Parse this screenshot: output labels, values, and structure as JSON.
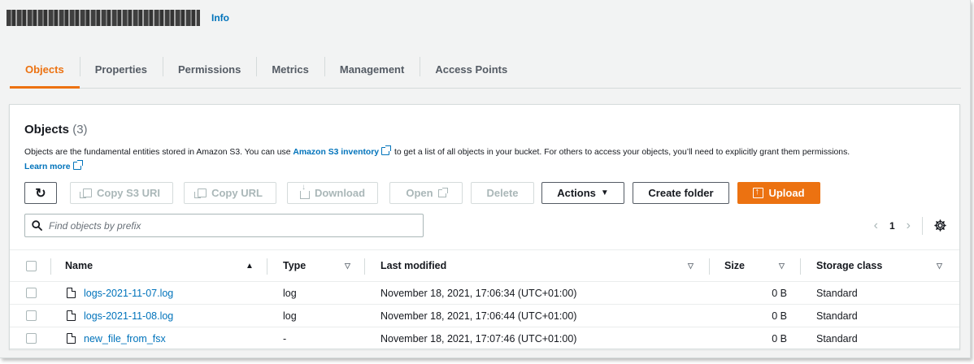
{
  "header": {
    "info_label": "Info"
  },
  "tabs": [
    {
      "label": "Objects",
      "active": true
    },
    {
      "label": "Properties"
    },
    {
      "label": "Permissions"
    },
    {
      "label": "Metrics"
    },
    {
      "label": "Management"
    },
    {
      "label": "Access Points"
    }
  ],
  "objects": {
    "title": "Objects",
    "count": "(3)",
    "description_part1": "Objects are the fundamental entities stored in Amazon S3. You can use ",
    "inventory_link": "Amazon S3 inventory",
    "description_part2": " to get a list of all objects in your bucket. For others to access your objects, you’ll need to explicitly grant them permissions.",
    "learn_more": "Learn more"
  },
  "toolbar": {
    "refresh_icon": "refresh-icon",
    "copy_s3_uri": "Copy S3 URI",
    "copy_url": "Copy URL",
    "download": "Download",
    "open": "Open",
    "delete": "Delete",
    "actions": "Actions",
    "create_folder": "Create folder",
    "upload": "Upload"
  },
  "search": {
    "placeholder": "Find objects by prefix"
  },
  "pagination": {
    "page": "1"
  },
  "table": {
    "columns": {
      "name": "Name",
      "type": "Type",
      "last_modified": "Last modified",
      "size": "Size",
      "storage_class": "Storage class"
    },
    "rows": [
      {
        "name": "logs-2021-11-07.log",
        "type": "log",
        "last_modified": "November 18, 2021, 17:06:34 (UTC+01:00)",
        "size": "0 B",
        "storage_class": "Standard"
      },
      {
        "name": "logs-2021-11-08.log",
        "type": "log",
        "last_modified": "November 18, 2021, 17:06:44 (UTC+01:00)",
        "size": "0 B",
        "storage_class": "Standard"
      },
      {
        "name": "new_file_from_fsx",
        "type": "-",
        "last_modified": "November 18, 2021, 17:07:46 (UTC+01:00)",
        "size": "0 B",
        "storage_class": "Standard"
      }
    ]
  },
  "colors": {
    "accent": "#ec7211",
    "link": "#0073bb"
  }
}
